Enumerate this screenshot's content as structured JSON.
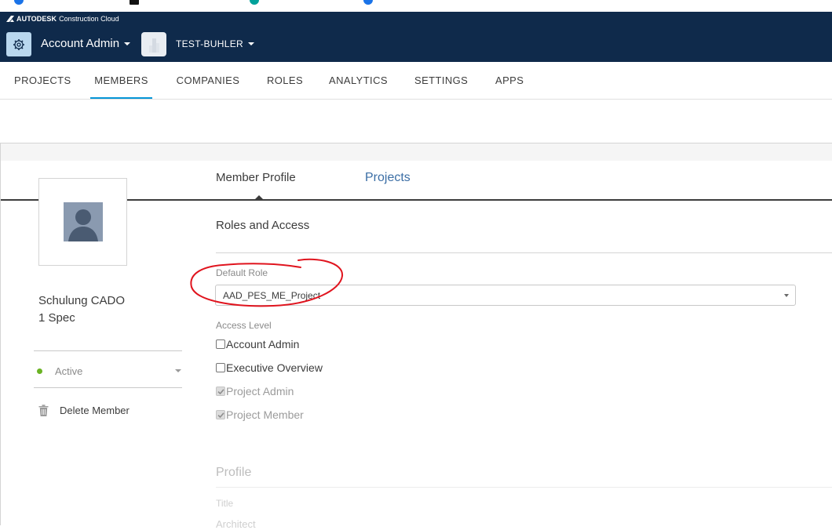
{
  "header": {
    "brand_name": "AUTODESK",
    "brand_product": "Construction Cloud",
    "app_switcher_label": "Account Admin",
    "project_switcher_label": "TEST-BUHLER",
    "background_color": "#0f2a4b"
  },
  "nav": {
    "tabs": [
      {
        "label": "PROJECTS"
      },
      {
        "label": "MEMBERS",
        "active": true
      },
      {
        "label": "COMPANIES"
      },
      {
        "label": "ROLES"
      },
      {
        "label": "ANALYTICS"
      },
      {
        "label": "SETTINGS"
      },
      {
        "label": "APPS"
      }
    ],
    "active_color": "#0696d7"
  },
  "member": {
    "name_line1": "Schulung CADO",
    "name_line2": "1 Spec",
    "status": "Active",
    "status_color": "#6bb324",
    "delete_label": "Delete Member"
  },
  "profile_tabs": {
    "member_profile": "Member Profile",
    "projects": "Projects"
  },
  "roles_access": {
    "section_title": "Roles and Access",
    "default_role_label": "Default Role",
    "default_role_value": "AAD_PES_ME_Project",
    "access_level_label": "Access Level",
    "access_levels": [
      {
        "label": "Account Admin",
        "checked": false,
        "disabled": false
      },
      {
        "label": "Executive Overview",
        "checked": false,
        "disabled": false
      },
      {
        "label": "Project Admin",
        "checked": true,
        "disabled": true
      },
      {
        "label": "Project Member",
        "checked": true,
        "disabled": true
      }
    ]
  },
  "profile": {
    "section_title": "Profile",
    "title_label": "Title",
    "title_value": "Architect"
  },
  "annotation_color": "#e0141e"
}
